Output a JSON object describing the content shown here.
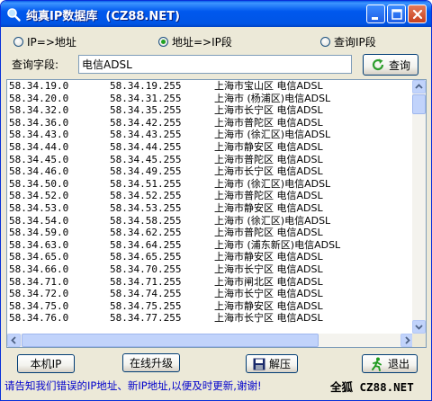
{
  "window": {
    "title": "纯真IP数据库  (CZ88.NET)"
  },
  "modes": [
    {
      "label": "IP=>地址",
      "selected": false
    },
    {
      "label": "地址=>IP段",
      "selected": true
    },
    {
      "label": "查询IP段",
      "selected": false
    }
  ],
  "query": {
    "label": "查询字段:",
    "value": "电信ADSL",
    "button_label": "查询"
  },
  "results": [
    [
      "58.34.19.0",
      "58.34.19.255",
      "上海市宝山区 电信ADSL"
    ],
    [
      "58.34.20.0",
      "58.34.31.255",
      "上海市 (杨浦区)电信ADSL"
    ],
    [
      "58.34.32.0",
      "58.34.35.255",
      "上海市长宁区 电信ADSL"
    ],
    [
      "58.34.36.0",
      "58.34.42.255",
      "上海市普陀区 电信ADSL"
    ],
    [
      "58.34.43.0",
      "58.34.43.255",
      "上海市 (徐汇区)电信ADSL"
    ],
    [
      "58.34.44.0",
      "58.34.44.255",
      "上海市静安区 电信ADSL"
    ],
    [
      "58.34.45.0",
      "58.34.45.255",
      "上海市普陀区 电信ADSL"
    ],
    [
      "58.34.46.0",
      "58.34.49.255",
      "上海市长宁区 电信ADSL"
    ],
    [
      "58.34.50.0",
      "58.34.51.255",
      "上海市 (徐汇区)电信ADSL"
    ],
    [
      "58.34.52.0",
      "58.34.52.255",
      "上海市普陀区 电信ADSL"
    ],
    [
      "58.34.53.0",
      "58.34.53.255",
      "上海市静安区 电信ADSL"
    ],
    [
      "58.34.54.0",
      "58.34.58.255",
      "上海市 (徐汇区)电信ADSL"
    ],
    [
      "58.34.59.0",
      "58.34.62.255",
      "上海市普陀区 电信ADSL"
    ],
    [
      "58.34.63.0",
      "58.34.64.255",
      "上海市 (浦东新区)电信ADSL"
    ],
    [
      "58.34.65.0",
      "58.34.65.255",
      "上海市静安区 电信ADSL"
    ],
    [
      "58.34.66.0",
      "58.34.70.255",
      "上海市长宁区 电信ADSL"
    ],
    [
      "58.34.71.0",
      "58.34.71.255",
      "上海市闸北区 电信ADSL"
    ],
    [
      "58.34.72.0",
      "58.34.74.255",
      "上海市长宁区 电信ADSL"
    ],
    [
      "58.34.75.0",
      "58.34.75.255",
      "上海市静安区 电信ADSL"
    ],
    [
      "58.34.76.0",
      "58.34.77.255",
      "上海市长宁区 电信ADSL"
    ]
  ],
  "buttons": {
    "local_ip": "本机IP",
    "online_upgrade": "在线升级",
    "extract": "解压",
    "exit": "退出"
  },
  "status_text": "请告知我们错误的IP地址、新IP地址,以便及时更新,谢谢!",
  "brand_text": "全狐 CZ88.NET",
  "colors": {
    "titlebar": "#0058EE",
    "status_text": "#0000CC",
    "selected_radio": "#21A121"
  },
  "icons": {
    "app": "magnifier-icon",
    "query": "refresh-icon",
    "extract": "floppy-disk-icon",
    "exit": "running-man-icon"
  }
}
